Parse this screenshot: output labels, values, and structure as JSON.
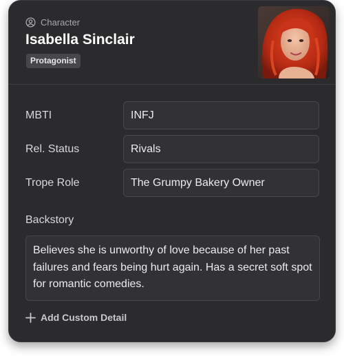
{
  "header": {
    "kind_icon": "user-circle-icon",
    "kind_label": "Character",
    "name": "Isabella Sinclair",
    "role_badge": "Protagonist",
    "avatar": "character-portrait"
  },
  "fields": [
    {
      "label": "MBTI",
      "value": "INFJ"
    },
    {
      "label": "Rel. Status",
      "value": "Rivals"
    },
    {
      "label": "Trope Role",
      "value": "The Grumpy Bakery Owner"
    }
  ],
  "backstory": {
    "label": "Backstory",
    "text": "Believes she is unworthy of love because of her past failures and fears being hurt again. Has a secret soft spot for romantic comedies."
  },
  "actions": {
    "add_icon": "plus-icon",
    "add_label": "Add Custom Detail"
  },
  "colors": {
    "card_bg": "#2b2b2d",
    "field_bg": "#323234",
    "border": "#474749",
    "badge_bg": "#47474b"
  }
}
